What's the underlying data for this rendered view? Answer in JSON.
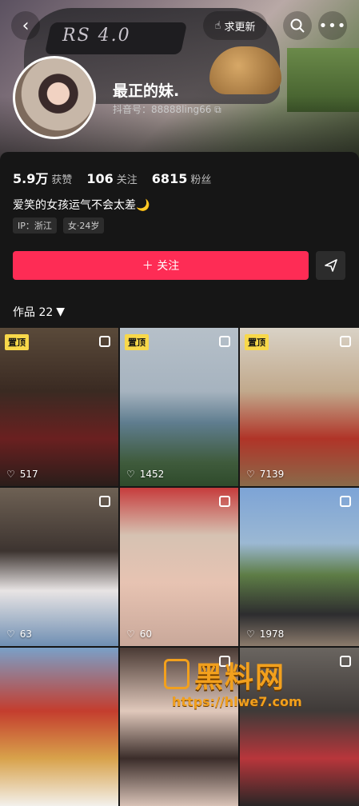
{
  "header": {
    "back_icon": "back-icon",
    "update_label": "求更新",
    "search_icon": "search-icon",
    "more_icon": "more-icon",
    "cover_text": "RS 4.0"
  },
  "profile": {
    "name": "最正的妹.",
    "douyin_id": "抖音号：88888ling66",
    "stats": [
      {
        "value": "5.9万",
        "label": "获赞"
      },
      {
        "value": "106",
        "label": "关注"
      },
      {
        "value": "6815",
        "label": "粉丝"
      }
    ],
    "bio": "爱笑的女孩运气不会太差🌙",
    "tags": [
      "IP：浙江",
      "女·24岁"
    ]
  },
  "actions": {
    "follow_label": "＋ 关注",
    "share_icon": "send-icon"
  },
  "works": {
    "label": "作品 22",
    "items": [
      {
        "pinned": "置顶",
        "likes": "517"
      },
      {
        "pinned": "置顶",
        "likes": "1452"
      },
      {
        "pinned": "置顶",
        "likes": "7139"
      },
      {
        "pinned": "",
        "likes": "63"
      },
      {
        "pinned": "",
        "likes": "60"
      },
      {
        "pinned": "",
        "likes": "1978"
      },
      {
        "pinned": "",
        "likes": ""
      },
      {
        "pinned": "",
        "likes": ""
      },
      {
        "pinned": "",
        "likes": ""
      }
    ]
  },
  "watermark": {
    "title": "黑料网",
    "url": "https://hlwe7.com"
  },
  "colors": {
    "accent": "#fe2c55",
    "pin": "#f8d84a",
    "background": "#161616"
  }
}
